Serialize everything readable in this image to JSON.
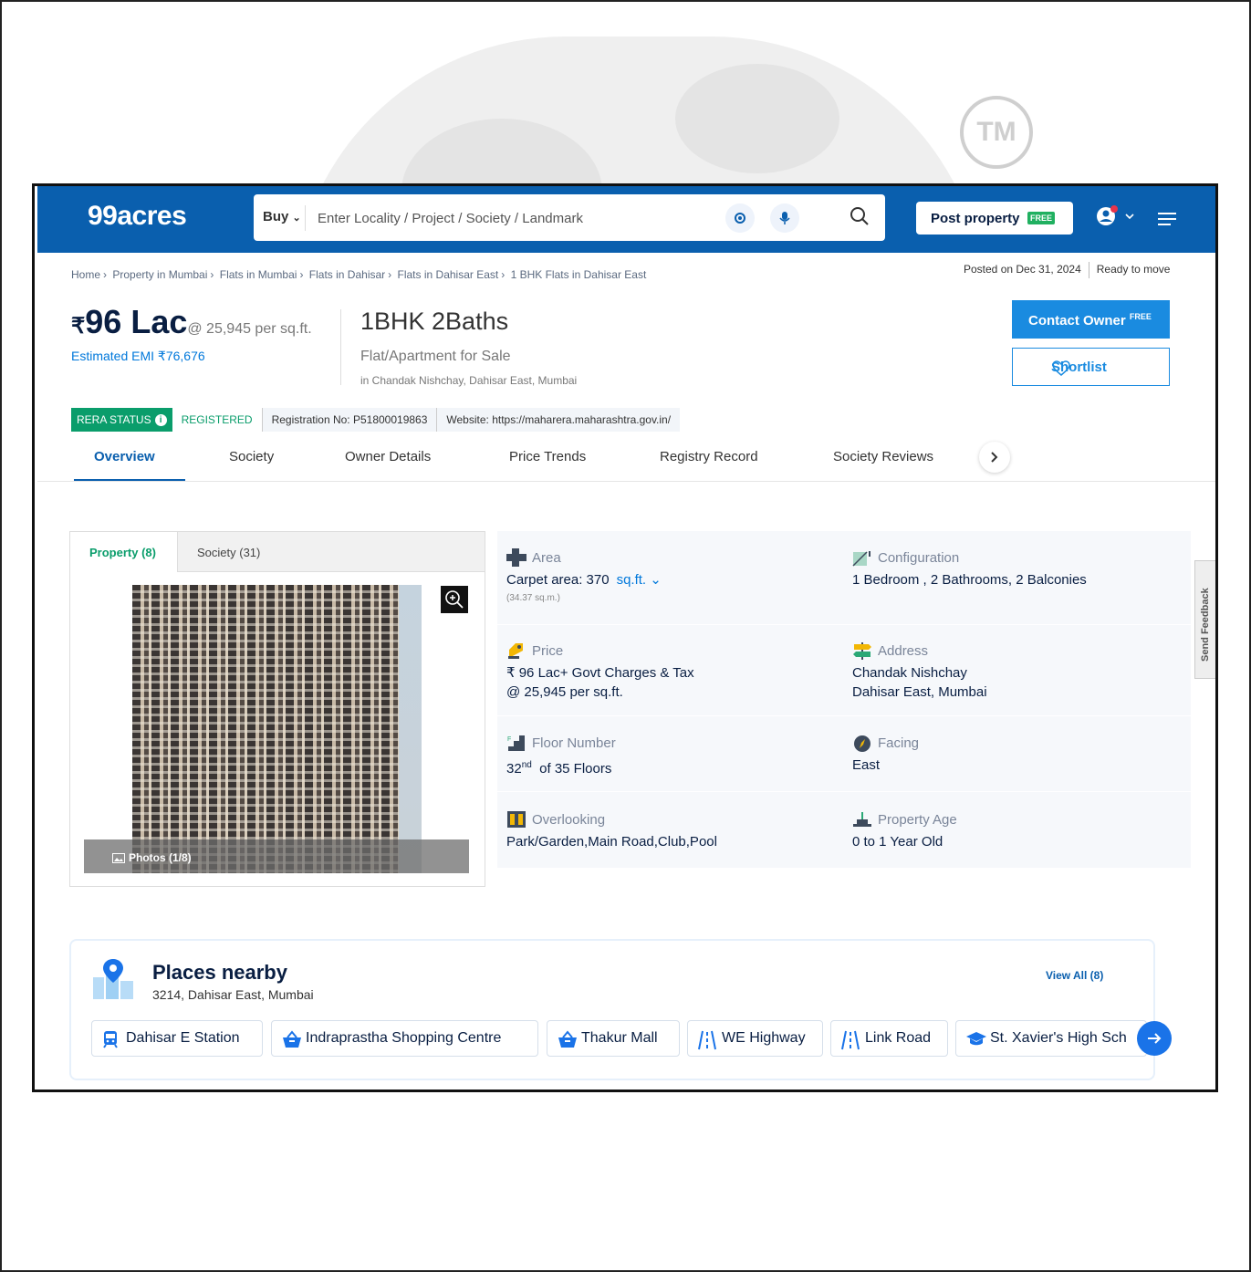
{
  "header": {
    "logo": "99acres",
    "buy_label": "Buy",
    "search_placeholder": "Enter Locality / Project / Society / Landmark",
    "post_property_label": "Post property",
    "post_free_tag": "FREE"
  },
  "breadcrumb": [
    "Home",
    "Property in Mumbai",
    "Flats in Mumbai",
    "Flats in Dahisar",
    "Flats in Dahisar East",
    "1 BHK Flats in Dahisar East"
  ],
  "posted": {
    "date": "Posted on Dec 31, 2024",
    "status": "Ready to move"
  },
  "listing": {
    "currency": "₹",
    "price": "96 Lac",
    "per_sqft": "@ 25,945 per sq.ft.",
    "emi": "Estimated EMI ₹76,676",
    "title": "1BHK 2Baths",
    "subtitle": "Flat/Apartment for Sale",
    "location": "in Chandak Nishchay, Dahisar East, Mumbai"
  },
  "actions": {
    "contact_label": "Contact Owner",
    "contact_free": "FREE",
    "shortlist_label": "Shortlist"
  },
  "rera": {
    "status_label": "RERA STATUS",
    "status_value": "REGISTERED",
    "registration": "Registration No: P51800019863",
    "website": "Website: https://maharera.maharashtra.gov.in/"
  },
  "tabs": [
    "Overview",
    "Society",
    "Owner Details",
    "Price Trends",
    "Registry Record",
    "Society Reviews"
  ],
  "gallery": {
    "tab_property": "Property (8)",
    "tab_society": "Society (31)",
    "photos_label": "Photos (1/8)"
  },
  "details": {
    "area": {
      "label": "Area",
      "value": "Carpet area: 370",
      "unit": "sq.ft.",
      "sub": "(34.37 sq.m.)"
    },
    "configuration": {
      "label": "Configuration",
      "value": "1 Bedroom , 2 Bathrooms, 2 Balconies"
    },
    "price": {
      "label": "Price",
      "line1": "₹ 96 Lac+ Govt Charges & Tax",
      "line2": "@ 25,945 per sq.ft."
    },
    "address": {
      "label": "Address",
      "line1": "Chandak Nishchay",
      "line2": "Dahisar East, Mumbai"
    },
    "floor": {
      "label": "Floor Number",
      "floor": "32",
      "suffix": "nd",
      "of": "of 35 Floors"
    },
    "facing": {
      "label": "Facing",
      "value": "East"
    },
    "overlooking": {
      "label": "Overlooking",
      "value": "Park/Garden,Main Road,Club,Pool"
    },
    "age": {
      "label": "Property Age",
      "value": "0 to 1 Year Old"
    }
  },
  "feedback_label": "Send Feedback",
  "nearby": {
    "title": "Places nearby",
    "address": "3214, Dahisar East, Mumbai",
    "view_all": "View All (8)",
    "places": [
      "Dahisar E Station",
      "Indraprastha Shopping Centre",
      "Thakur Mall",
      "WE Highway",
      "Link Road",
      "St. Xavier's High Sch"
    ]
  },
  "watermark": "TM",
  "colors": {
    "brand": "#0a5fae",
    "accent": "#1a8be0",
    "rera_green": "#0a9d6b"
  }
}
